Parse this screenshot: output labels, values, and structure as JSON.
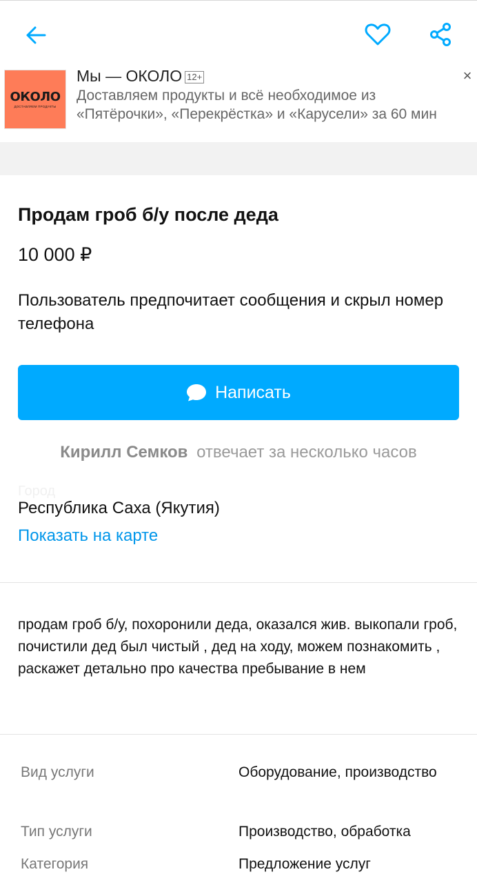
{
  "header": {
    "back_icon": "arrow-left-icon",
    "favorite_icon": "heart-icon",
    "share_icon": "share-icon",
    "accent_color": "#00aaff"
  },
  "ad": {
    "logo_text": "ОКОЛО",
    "logo_tagline": "ДОСТАВЛЯЕМ ПРОДУКТЫ",
    "title": "Мы — ОКОЛО",
    "age": "12+",
    "text": "Доставляем продукты и всё необходимое из «Пятёрочки», «Перекрёстка» и «Карусели» за 60 мин",
    "close": "×"
  },
  "listing": {
    "title": "Продам гроб б/у после деда",
    "price": "10 000 ₽",
    "contact_preference": "Пользователь предпочитает сообщения и скрыл номер телефона",
    "write_button": "Написать",
    "seller_name": "Кирилл Семков",
    "seller_response": "отвечает за несколько часов",
    "city_label": "Город",
    "region": "Республика Саха (Якутия)",
    "map_link": "Показать на карте",
    "description": "продам гроб б/у, похоронили деда, оказался жив. выкопали гроб, почистили дед был чистый , дед на ходу, можем познакомить , раскажет детально про качества пребывание в нем"
  },
  "params": [
    {
      "key": "Вид услуги",
      "value": "Оборудование, производство"
    },
    {
      "key": "Тип услуги",
      "value": "Производство, обработка"
    },
    {
      "key": "Категория",
      "value": "Предложение услуг"
    }
  ]
}
